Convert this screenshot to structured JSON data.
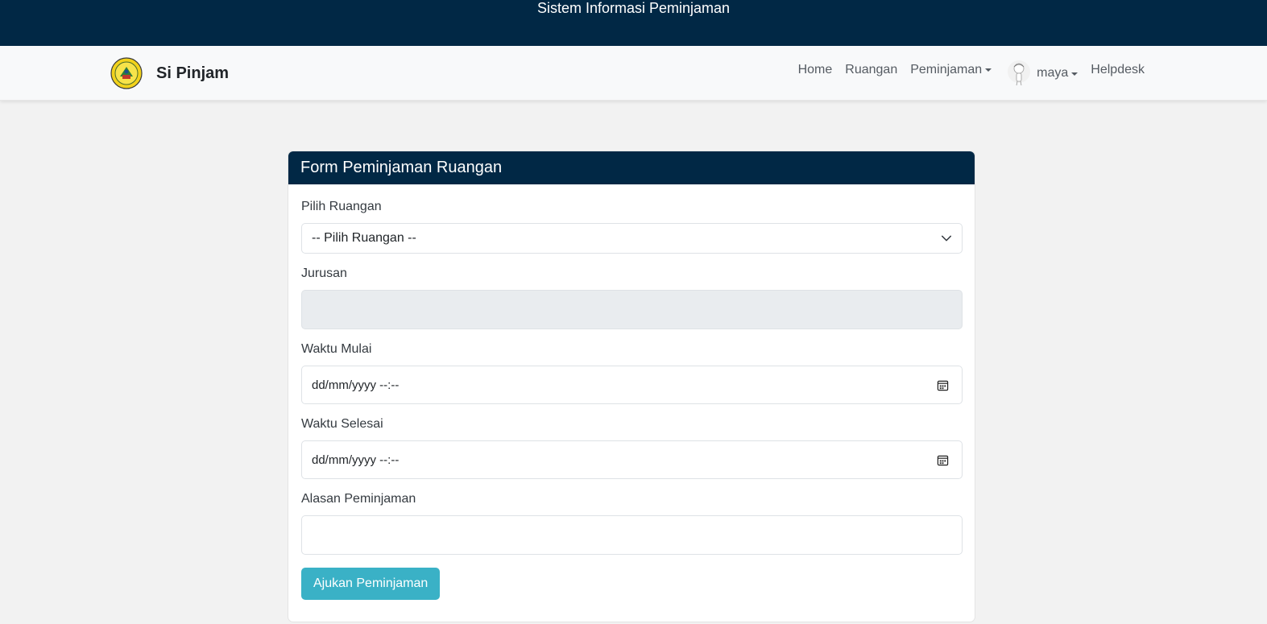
{
  "topbar": {
    "title": "Sistem Informasi Peminjaman"
  },
  "navbar": {
    "brand": "Si Pinjam",
    "links": {
      "home": "Home",
      "ruangan": "Ruangan",
      "peminjaman": "Peminjaman",
      "user": "maya",
      "helpdesk": "Helpdesk"
    }
  },
  "form": {
    "header": "Form Peminjaman Ruangan",
    "ruangan_label": "Pilih Ruangan",
    "ruangan_value": "-- Pilih Ruangan --",
    "jurusan_label": "Jurusan",
    "mulai_label": "Waktu Mulai",
    "mulai_value": "dd/mm/yyyy --:--",
    "selesai_label": "Waktu Selesai",
    "selesai_value": "dd/mm/yyyy --:--",
    "alasan_label": "Alasan Peminjaman",
    "submit": "Ajukan Peminjaman"
  },
  "colors": {
    "primary_dark": "#012845",
    "button": "#3ab1c6",
    "background": "#f2f2f2"
  },
  "icons": [
    "university-logo",
    "chevron-down-icon",
    "calendar-icon",
    "user-avatar"
  ]
}
